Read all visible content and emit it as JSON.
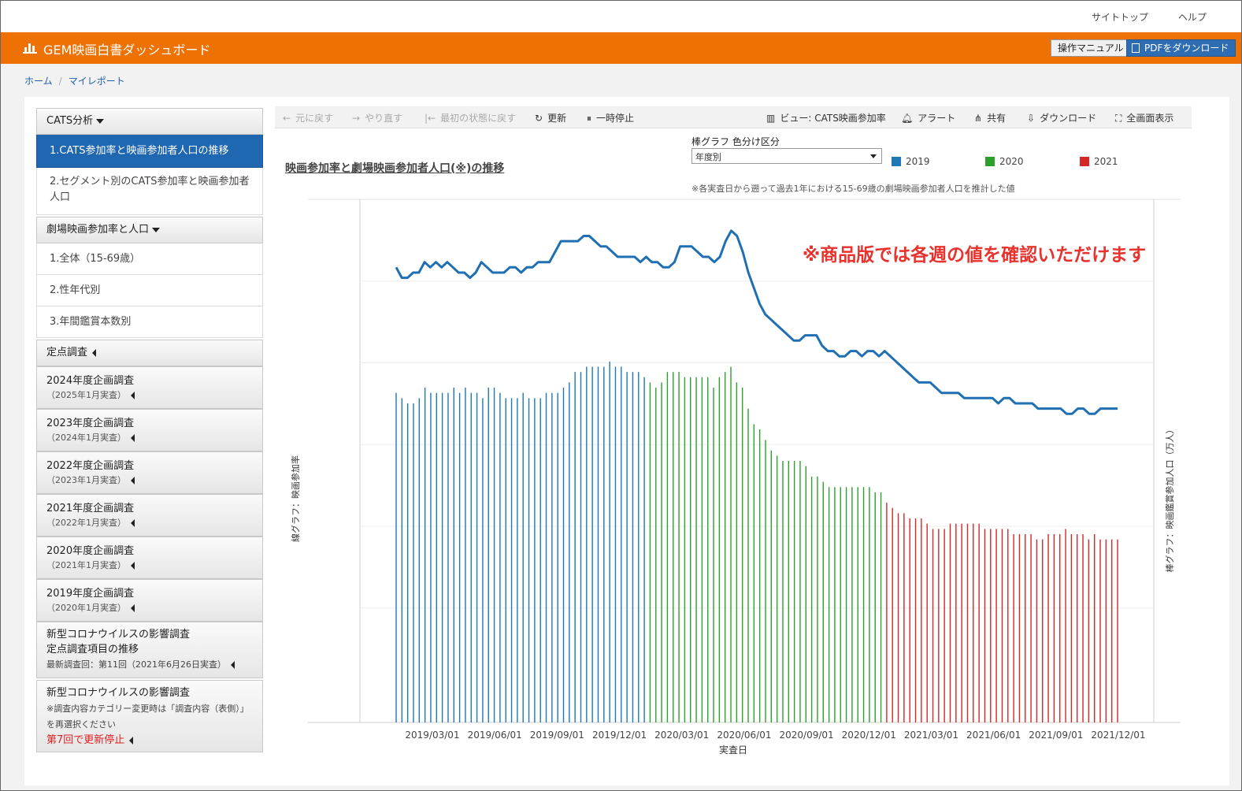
{
  "top_links": {
    "site_top": "サイトトップ",
    "help": "ヘルプ"
  },
  "header": {
    "title": "GEM映画白書ダッシュボード",
    "manual_button": "操作マニュアル",
    "pdf_button": "PDFをダウンロード",
    "accent_color": "#ee7203"
  },
  "breadcrumb": {
    "home": "ホーム",
    "current": "マイレポート"
  },
  "sidebar": {
    "cats_section": "CATS分析",
    "cats_items": [
      "1.CATS参加率と映画参加者人口の推移",
      "2.セグメント別のCATS参加率と映画参加者人口"
    ],
    "theater_section": "劇場映画参加率と人口",
    "theater_items": [
      "1.全体（15-69歳）",
      "2.性年代別",
      "3.年間鑑賞本数別"
    ],
    "fixed_section": "定点調査",
    "surveys": [
      {
        "title": "2024年度企画調査",
        "date": "（2025年1月実査）"
      },
      {
        "title": "2023年度企画調査",
        "date": "（2024年1月実査）"
      },
      {
        "title": "2022年度企画調査",
        "date": "（2023年1月実査）"
      },
      {
        "title": "2021年度企画調査",
        "date": "（2022年1月実査）"
      },
      {
        "title": "2020年度企画調査",
        "date": "（2021年1月実査）"
      },
      {
        "title": "2019年度企画調査",
        "date": "（2020年1月実査）"
      }
    ],
    "covid1": {
      "line1": "新型コロナウイルスの影響調査",
      "line2": "定点調査項目の推移",
      "latest": "最新調査回：第11回（2021年6月26日実査）"
    },
    "covid2": {
      "title": "新型コロナウイルスの影響調査",
      "note1": "※調査内容カテゴリー変更時は「調査内容（表側）」",
      "note2": "を再選択ください",
      "stopped": "第7回で更新停止"
    }
  },
  "toolbar": {
    "undo": "元に戻す",
    "redo": "やり直す",
    "revert": "最初の状態に戻す",
    "refresh": "更新",
    "pause": "一時停止",
    "view": "ビュー: CATS映画参加率",
    "alert": "アラート",
    "share": "共有",
    "download": "ダウンロード",
    "fullscreen": "全画面表示"
  },
  "chart_controls": {
    "title": "映画参加率と劇場映画参加者人口(※)の推移",
    "color_label": "棒グラフ 色分け区分",
    "color_value": "年度別",
    "note": "※各実査日から遡って過去1年における15-69歳の劇場映画参加者人口を推計した値",
    "legend": [
      {
        "name": "2019",
        "color": "#1f77b4"
      },
      {
        "name": "2020",
        "color": "#2ca02c"
      },
      {
        "name": "2021",
        "color": "#d62728"
      }
    ]
  },
  "chart_data": {
    "type": "bar",
    "xlabel": "実査日",
    "ylabel_left": "線グラフ：映画参加率",
    "ylabel_right": "棒グラフ：映画鑑賞参加人口（万人）",
    "overlay_text": "※商品版では各週の値を確認いただけます",
    "x_ticks": [
      "2019/03/01",
      "2019/06/01",
      "2019/09/01",
      "2019/12/01",
      "2020/03/01",
      "2020/06/01",
      "2020/09/01",
      "2020/12/01",
      "2021/03/01",
      "2021/06/01",
      "2021/09/01",
      "2021/12/01"
    ],
    "series": [
      {
        "name": "2019",
        "kind": "bar",
        "color": "#1f77b4",
        "values": [
          0.63,
          0.62,
          0.61,
          0.61,
          0.62,
          0.64,
          0.63,
          0.63,
          0.63,
          0.63,
          0.64,
          0.63,
          0.64,
          0.63,
          0.63,
          0.62,
          0.64,
          0.64,
          0.63,
          0.62,
          0.62,
          0.62,
          0.63,
          0.62,
          0.62,
          0.62,
          0.63,
          0.63,
          0.63,
          0.64,
          0.65,
          0.67,
          0.67,
          0.68,
          0.68,
          0.68,
          0.68,
          0.69,
          0.68,
          0.68,
          0.67,
          0.67,
          0.67,
          0.66
        ]
      },
      {
        "name": "2020",
        "kind": "bar",
        "color": "#2ca02c",
        "values": [
          0.65,
          0.64,
          0.65,
          0.67,
          0.67,
          0.67,
          0.66,
          0.66,
          0.66,
          0.66,
          0.66,
          0.64,
          0.66,
          0.67,
          0.68,
          0.65,
          0.64,
          0.6,
          0.57,
          0.56,
          0.54,
          0.52,
          0.51,
          0.5,
          0.5,
          0.5,
          0.5,
          0.49,
          0.47,
          0.47,
          0.46,
          0.45,
          0.45,
          0.45,
          0.45,
          0.45,
          0.45,
          0.45,
          0.45,
          0.44,
          0.44
        ]
      },
      {
        "name": "2021",
        "kind": "bar",
        "color": "#d62728",
        "values": [
          0.42,
          0.41,
          0.4,
          0.4,
          0.39,
          0.39,
          0.39,
          0.38,
          0.37,
          0.37,
          0.37,
          0.38,
          0.38,
          0.38,
          0.38,
          0.38,
          0.38,
          0.37,
          0.37,
          0.37,
          0.37,
          0.37,
          0.36,
          0.36,
          0.36,
          0.36,
          0.35,
          0.35,
          0.36,
          0.36,
          0.36,
          0.37,
          0.36,
          0.36,
          0.36,
          0.35,
          0.36,
          0.35,
          0.35,
          0.35,
          0.35
        ]
      },
      {
        "name": "映画参加率",
        "kind": "line",
        "color": "#1f6fb2",
        "values": [
          0.87,
          0.85,
          0.85,
          0.86,
          0.86,
          0.88,
          0.87,
          0.88,
          0.87,
          0.88,
          0.87,
          0.86,
          0.86,
          0.85,
          0.86,
          0.88,
          0.87,
          0.86,
          0.86,
          0.86,
          0.87,
          0.87,
          0.86,
          0.87,
          0.87,
          0.88,
          0.88,
          0.88,
          0.9,
          0.92,
          0.92,
          0.92,
          0.92,
          0.93,
          0.93,
          0.92,
          0.91,
          0.91,
          0.9,
          0.89,
          0.89,
          0.89,
          0.89,
          0.88,
          0.89,
          0.88,
          0.88,
          0.87,
          0.87,
          0.88,
          0.91,
          0.91,
          0.91,
          0.9,
          0.89,
          0.89,
          0.88,
          0.89,
          0.92,
          0.94,
          0.93,
          0.9,
          0.86,
          0.83,
          0.8,
          0.78,
          0.77,
          0.76,
          0.75,
          0.74,
          0.73,
          0.73,
          0.74,
          0.74,
          0.74,
          0.72,
          0.71,
          0.71,
          0.7,
          0.7,
          0.71,
          0.71,
          0.7,
          0.71,
          0.71,
          0.7,
          0.71,
          0.7,
          0.69,
          0.68,
          0.67,
          0.66,
          0.65,
          0.65,
          0.65,
          0.64,
          0.63,
          0.63,
          0.63,
          0.63,
          0.62,
          0.62,
          0.62,
          0.62,
          0.62,
          0.62,
          0.61,
          0.62,
          0.62,
          0.61,
          0.61,
          0.61,
          0.61,
          0.6,
          0.6,
          0.6,
          0.6,
          0.6,
          0.59,
          0.59,
          0.6,
          0.6,
          0.59,
          0.59,
          0.6,
          0.6,
          0.6,
          0.6
        ]
      }
    ]
  }
}
